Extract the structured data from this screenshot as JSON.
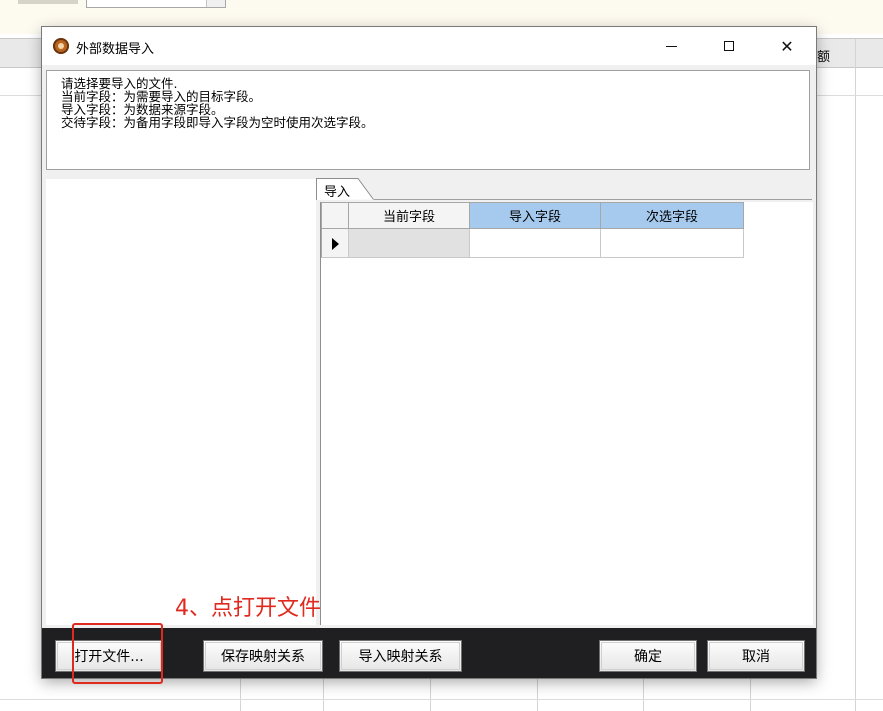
{
  "background": {
    "column_header": "额"
  },
  "dialog": {
    "title": "外部数据导入",
    "window_buttons": {
      "close_glyph": "✕"
    },
    "instructions": [
      "请选择要导入的文件.",
      "当前字段：为需要导入的目标字段。",
      "导入字段：为数据来源字段。",
      "交待字段：为备用字段即导入字段为空时使用次选字段。"
    ],
    "tab": {
      "label": "导入"
    },
    "grid": {
      "columns": [
        "当前字段",
        "导入字段",
        "次选字段"
      ],
      "rows": [
        [
          "",
          "",
          ""
        ]
      ]
    },
    "buttons": {
      "open_file": "打开文件...",
      "save_mapping": "保存映射关系",
      "import_mapping": "导入映射关系",
      "ok": "确定",
      "cancel": "取消"
    }
  },
  "annotation": {
    "text": "4、点打开文件",
    "color": "#e02a1f"
  }
}
